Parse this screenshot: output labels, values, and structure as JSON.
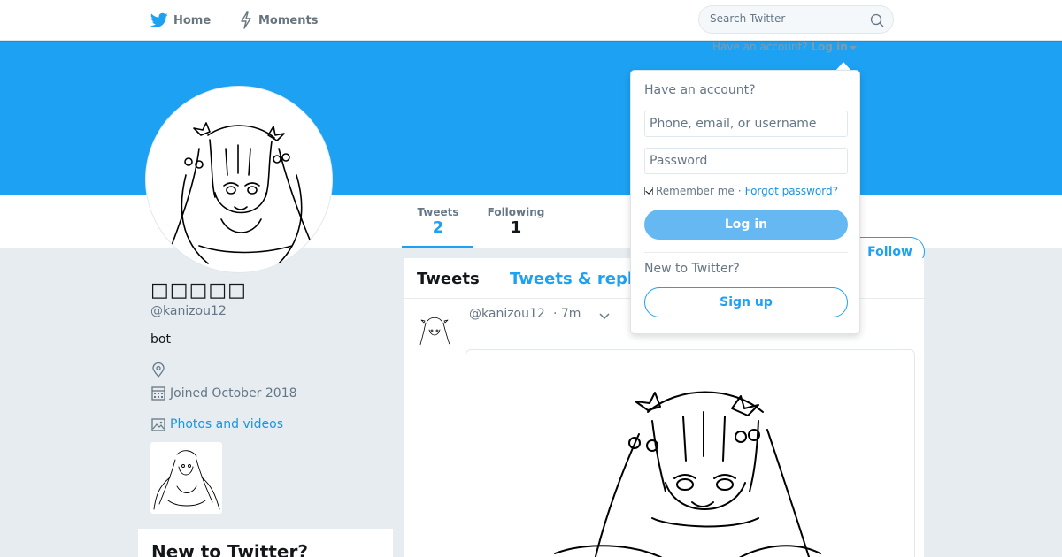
{
  "nav": {
    "home_label": "Home",
    "moments_label": "Moments",
    "search_placeholder": "Search Twitter"
  },
  "banner": {
    "have_account": "Have an account?",
    "login_link": "Log in"
  },
  "profile": {
    "display_name": "□□□□□",
    "handle": "@kanizou12",
    "bio": "bot",
    "joined": "Joined October 2018",
    "photos_link": "Photos and videos",
    "follow_label": "Follow"
  },
  "stats": [
    {
      "label": "Tweets",
      "value": "2"
    },
    {
      "label": "Following",
      "value": "1"
    }
  ],
  "timeline": {
    "tabs": [
      "Tweets",
      "Tweets & repl"
    ],
    "tweet": {
      "handle": "@kanizou12",
      "time": "· 7m"
    }
  },
  "side_card": {
    "title": "New to Twitter?"
  },
  "login_dropdown": {
    "title": "Have an account?",
    "username_placeholder": "Phone, email, or username",
    "password_placeholder": "Password",
    "remember_me": "Remember me",
    "separator": "·",
    "forgot_password": "Forgot password?",
    "login_button": "Log in",
    "new_to_twitter": "New to Twitter?",
    "signup_button": "Sign up"
  },
  "colors": {
    "accent": "#1da1f2",
    "banner": "#1da1f2",
    "page_bg": "#e6ecf0"
  },
  "icons": [
    "twitter-bird-icon",
    "lightning-icon",
    "search-icon",
    "location-icon",
    "calendar-icon",
    "image-icon",
    "chevron-down-icon",
    "caret-down-icon"
  ]
}
